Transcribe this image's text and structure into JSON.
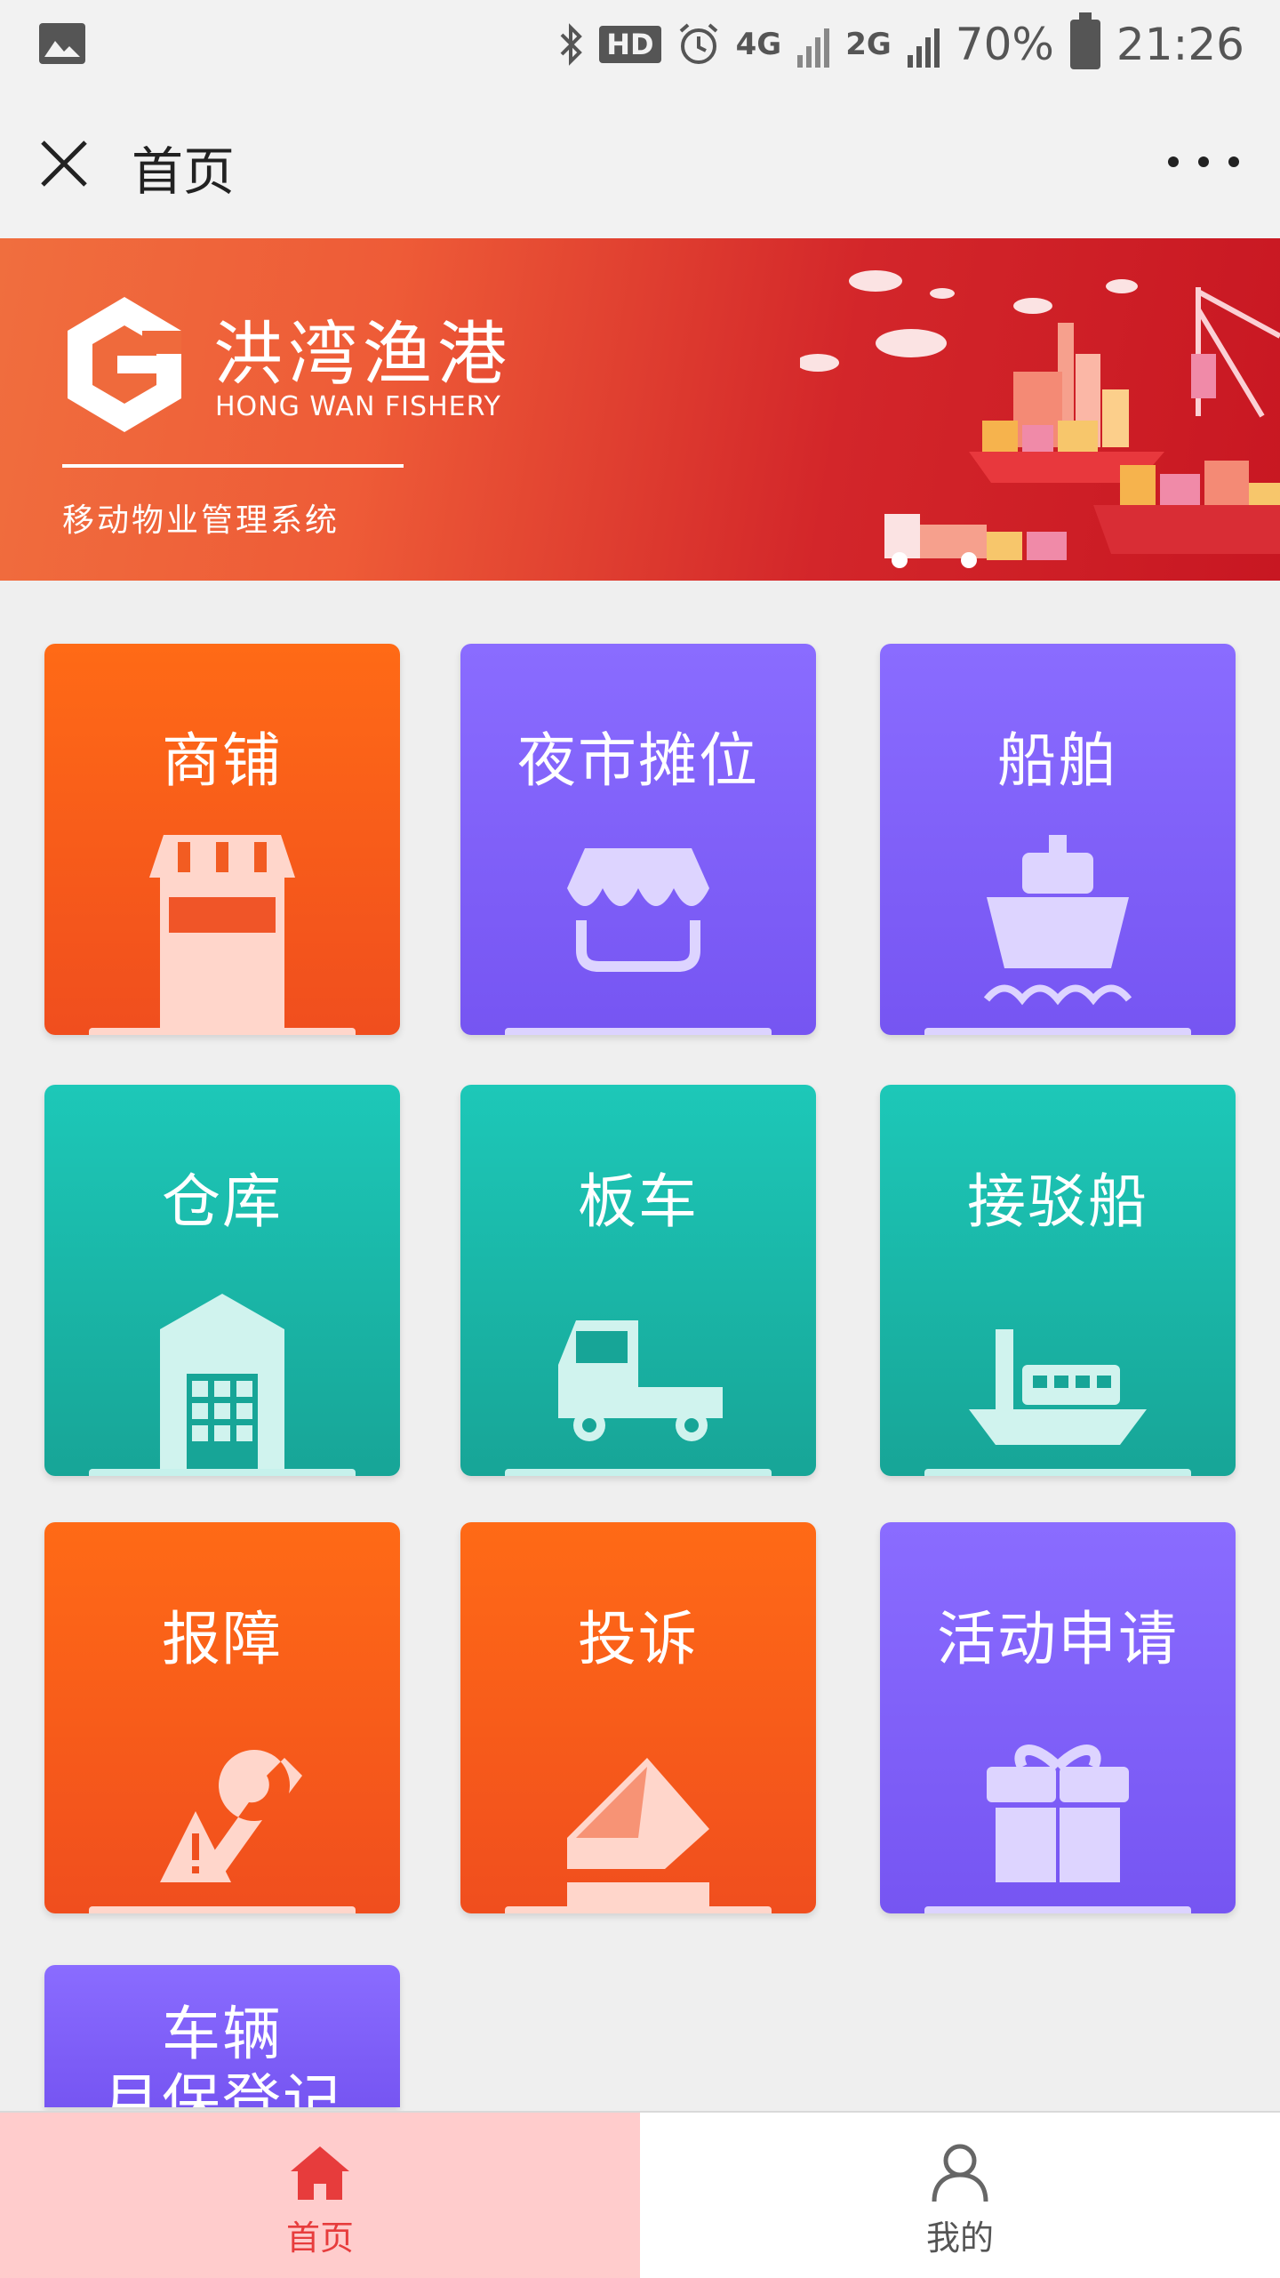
{
  "status_bar": {
    "network_4g": "4G",
    "network_2g": "2G",
    "hd": "HD",
    "battery_percent": "70%",
    "time": "21:26",
    "icons": [
      "image-icon",
      "bluetooth-icon",
      "hd-icon",
      "alarm-icon",
      "signal-icon",
      "battery-icon"
    ]
  },
  "title_bar": {
    "title": "首页"
  },
  "banner": {
    "brand_name": "洪湾渔港",
    "brand_en": "HONG WAN FISHERY",
    "subtitle": "移动物业管理系统"
  },
  "tiles": [
    {
      "label": "商铺",
      "icon": "shop-icon",
      "color": "orange"
    },
    {
      "label": "夜市摊位",
      "icon": "stall-icon",
      "color": "purple"
    },
    {
      "label": "船舶",
      "icon": "ship-icon",
      "color": "purple"
    },
    {
      "label": "仓库",
      "icon": "warehouse-icon",
      "color": "teal"
    },
    {
      "label": "板车",
      "icon": "truck-icon",
      "color": "teal"
    },
    {
      "label": "接驳船",
      "icon": "ferry-icon",
      "color": "teal"
    },
    {
      "label": "报障",
      "icon": "repair-icon",
      "color": "orange"
    },
    {
      "label": "投诉",
      "icon": "complaint-icon",
      "color": "orange"
    },
    {
      "label": "活动申请",
      "icon": "gift-icon",
      "color": "purple"
    },
    {
      "label": "车辆\n月保登记",
      "icon": "vehicle-icon",
      "color": "purple"
    }
  ],
  "tile_label_partial_line1": "车辆",
  "tile_label_partial_line2": "月保登记",
  "bottom_nav": {
    "home": "首页",
    "mine": "我的"
  },
  "colors": {
    "orange": "#ff6a16",
    "purple": "#8a6cff",
    "teal": "#1dc8b8",
    "active_nav_bg": "#ffcccc",
    "active_nav_text": "#e73c3c"
  }
}
